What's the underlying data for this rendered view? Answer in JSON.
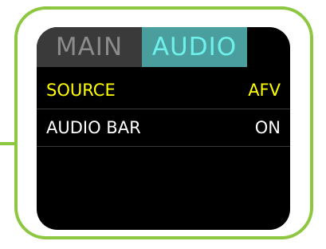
{
  "tabs": [
    {
      "label": "MAIN",
      "active": false
    },
    {
      "label": "AUDIO",
      "active": true
    }
  ],
  "menu": {
    "items": [
      {
        "label": "SOURCE",
        "value": "AFV",
        "selected": true
      },
      {
        "label": "AUDIO BAR",
        "value": "ON",
        "selected": false
      }
    ]
  },
  "colors": {
    "frame": "#8dc63f",
    "screen_bg": "#000000",
    "tab_main_bg": "#3a3a3a",
    "tab_main_text": "#8c8c8c",
    "tab_active_bg": "#4a9e9e",
    "tab_active_text": "#6ff0ea",
    "selected_text": "#ffff00",
    "normal_text": "#ffffff"
  }
}
